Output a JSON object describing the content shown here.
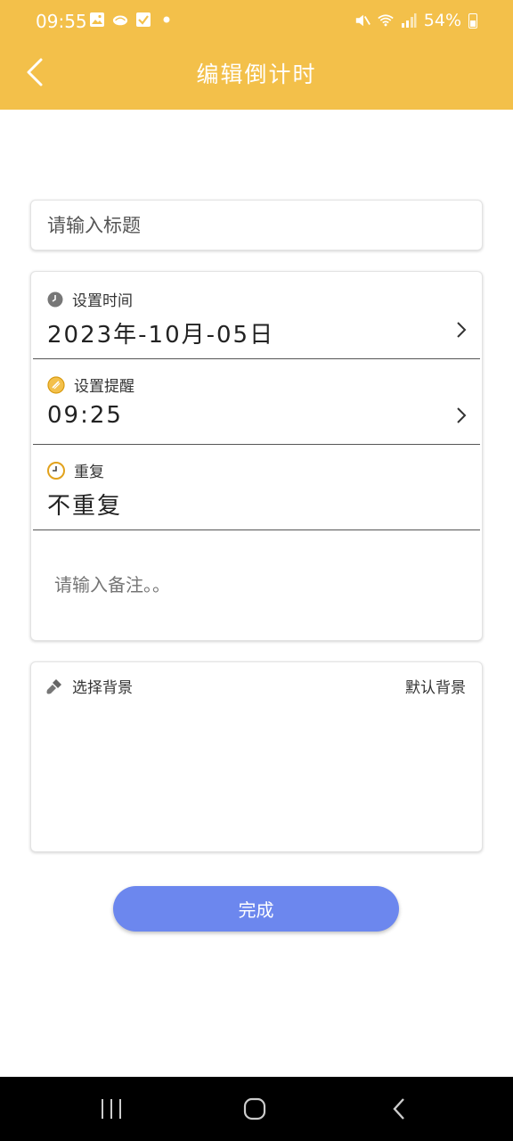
{
  "status_bar": {
    "time": "09:55",
    "battery": "54%",
    "icons": [
      "gallery-icon",
      "cloud-icon",
      "checkbox-icon",
      "dot-icon",
      "mute-icon",
      "wifi-icon",
      "signal-icon",
      "battery-icon"
    ]
  },
  "header": {
    "title": "编辑倒计时",
    "background_color": "#F3C04A"
  },
  "title_field": {
    "placeholder": "请输入标题",
    "value": ""
  },
  "settings": {
    "time": {
      "label": "设置时间",
      "value": "2023年-10月-05日",
      "icon": "clock-icon"
    },
    "reminder": {
      "label": "设置提醒",
      "value": "09:25",
      "icon": "alarm-icon"
    },
    "repeat": {
      "label": "重复",
      "value": "不重复",
      "icon": "repeat-clock-icon"
    },
    "note_placeholder": "请输入备注。。"
  },
  "background": {
    "label": "选择背景",
    "default_label": "默认背景",
    "icon": "brush-icon"
  },
  "done_button": {
    "label": "完成",
    "color": "#6C87EE"
  },
  "nav_bar": {
    "icons": [
      "recent-apps-icon",
      "home-icon",
      "back-icon"
    ]
  }
}
